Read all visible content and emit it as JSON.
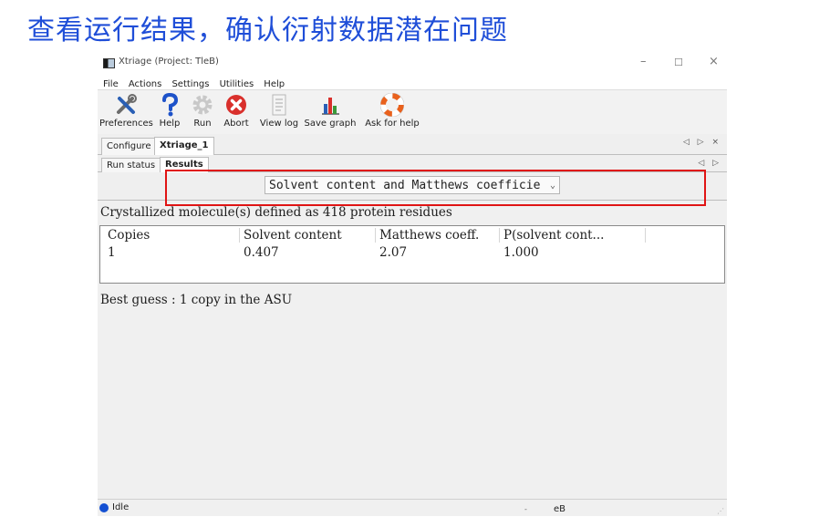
{
  "slide": {
    "title": "查看运行结果，确认衍射数据潜在问题"
  },
  "window": {
    "title": "Xtriage (Project: TleB)",
    "controls": {
      "minimize": "–",
      "maximize": "☐",
      "close": "×"
    }
  },
  "menu": [
    "File",
    "Actions",
    "Settings",
    "Utilities",
    "Help"
  ],
  "toolbar": [
    {
      "label": "Preferences",
      "icon": "tools-icon"
    },
    {
      "label": "Help",
      "icon": "question-icon"
    },
    {
      "label": "Run",
      "icon": "gear-icon"
    },
    {
      "label": "Abort",
      "icon": "abort-icon"
    },
    {
      "label": "View log",
      "icon": "log-icon"
    },
    {
      "label": "Save graph",
      "icon": "bar-chart-icon"
    },
    {
      "label": "Ask for help",
      "icon": "lifebuoy-icon"
    }
  ],
  "tabs": {
    "outer": [
      "Configure",
      "Xtriage_1"
    ],
    "outer_active": "Xtriage_1",
    "outer_arrows": "◁ ▷ ×",
    "inner": [
      "Run status",
      "Results"
    ],
    "inner_active": "Results",
    "inner_arrows": "◁ ▷"
  },
  "selector": {
    "value": "Solvent content and Matthews coefficie",
    "chevron": "⌄"
  },
  "results": {
    "summary": "Crystallized molecule(s) defined as 418 protein residues",
    "columns": [
      "Copies",
      "Solvent content",
      "Matthews coeff.",
      "P(solvent cont..."
    ],
    "rows": [
      [
        "1",
        "0.407",
        "2.07",
        "1.000"
      ]
    ],
    "best_guess": "Best guess :  1 copy in the ASU"
  },
  "status": {
    "text": "Idle",
    "dot_color": "#1450d2",
    "right": "eB",
    "mid": "-"
  },
  "accent": {
    "title": "#1f4ed8",
    "highlight": "#e01414"
  }
}
